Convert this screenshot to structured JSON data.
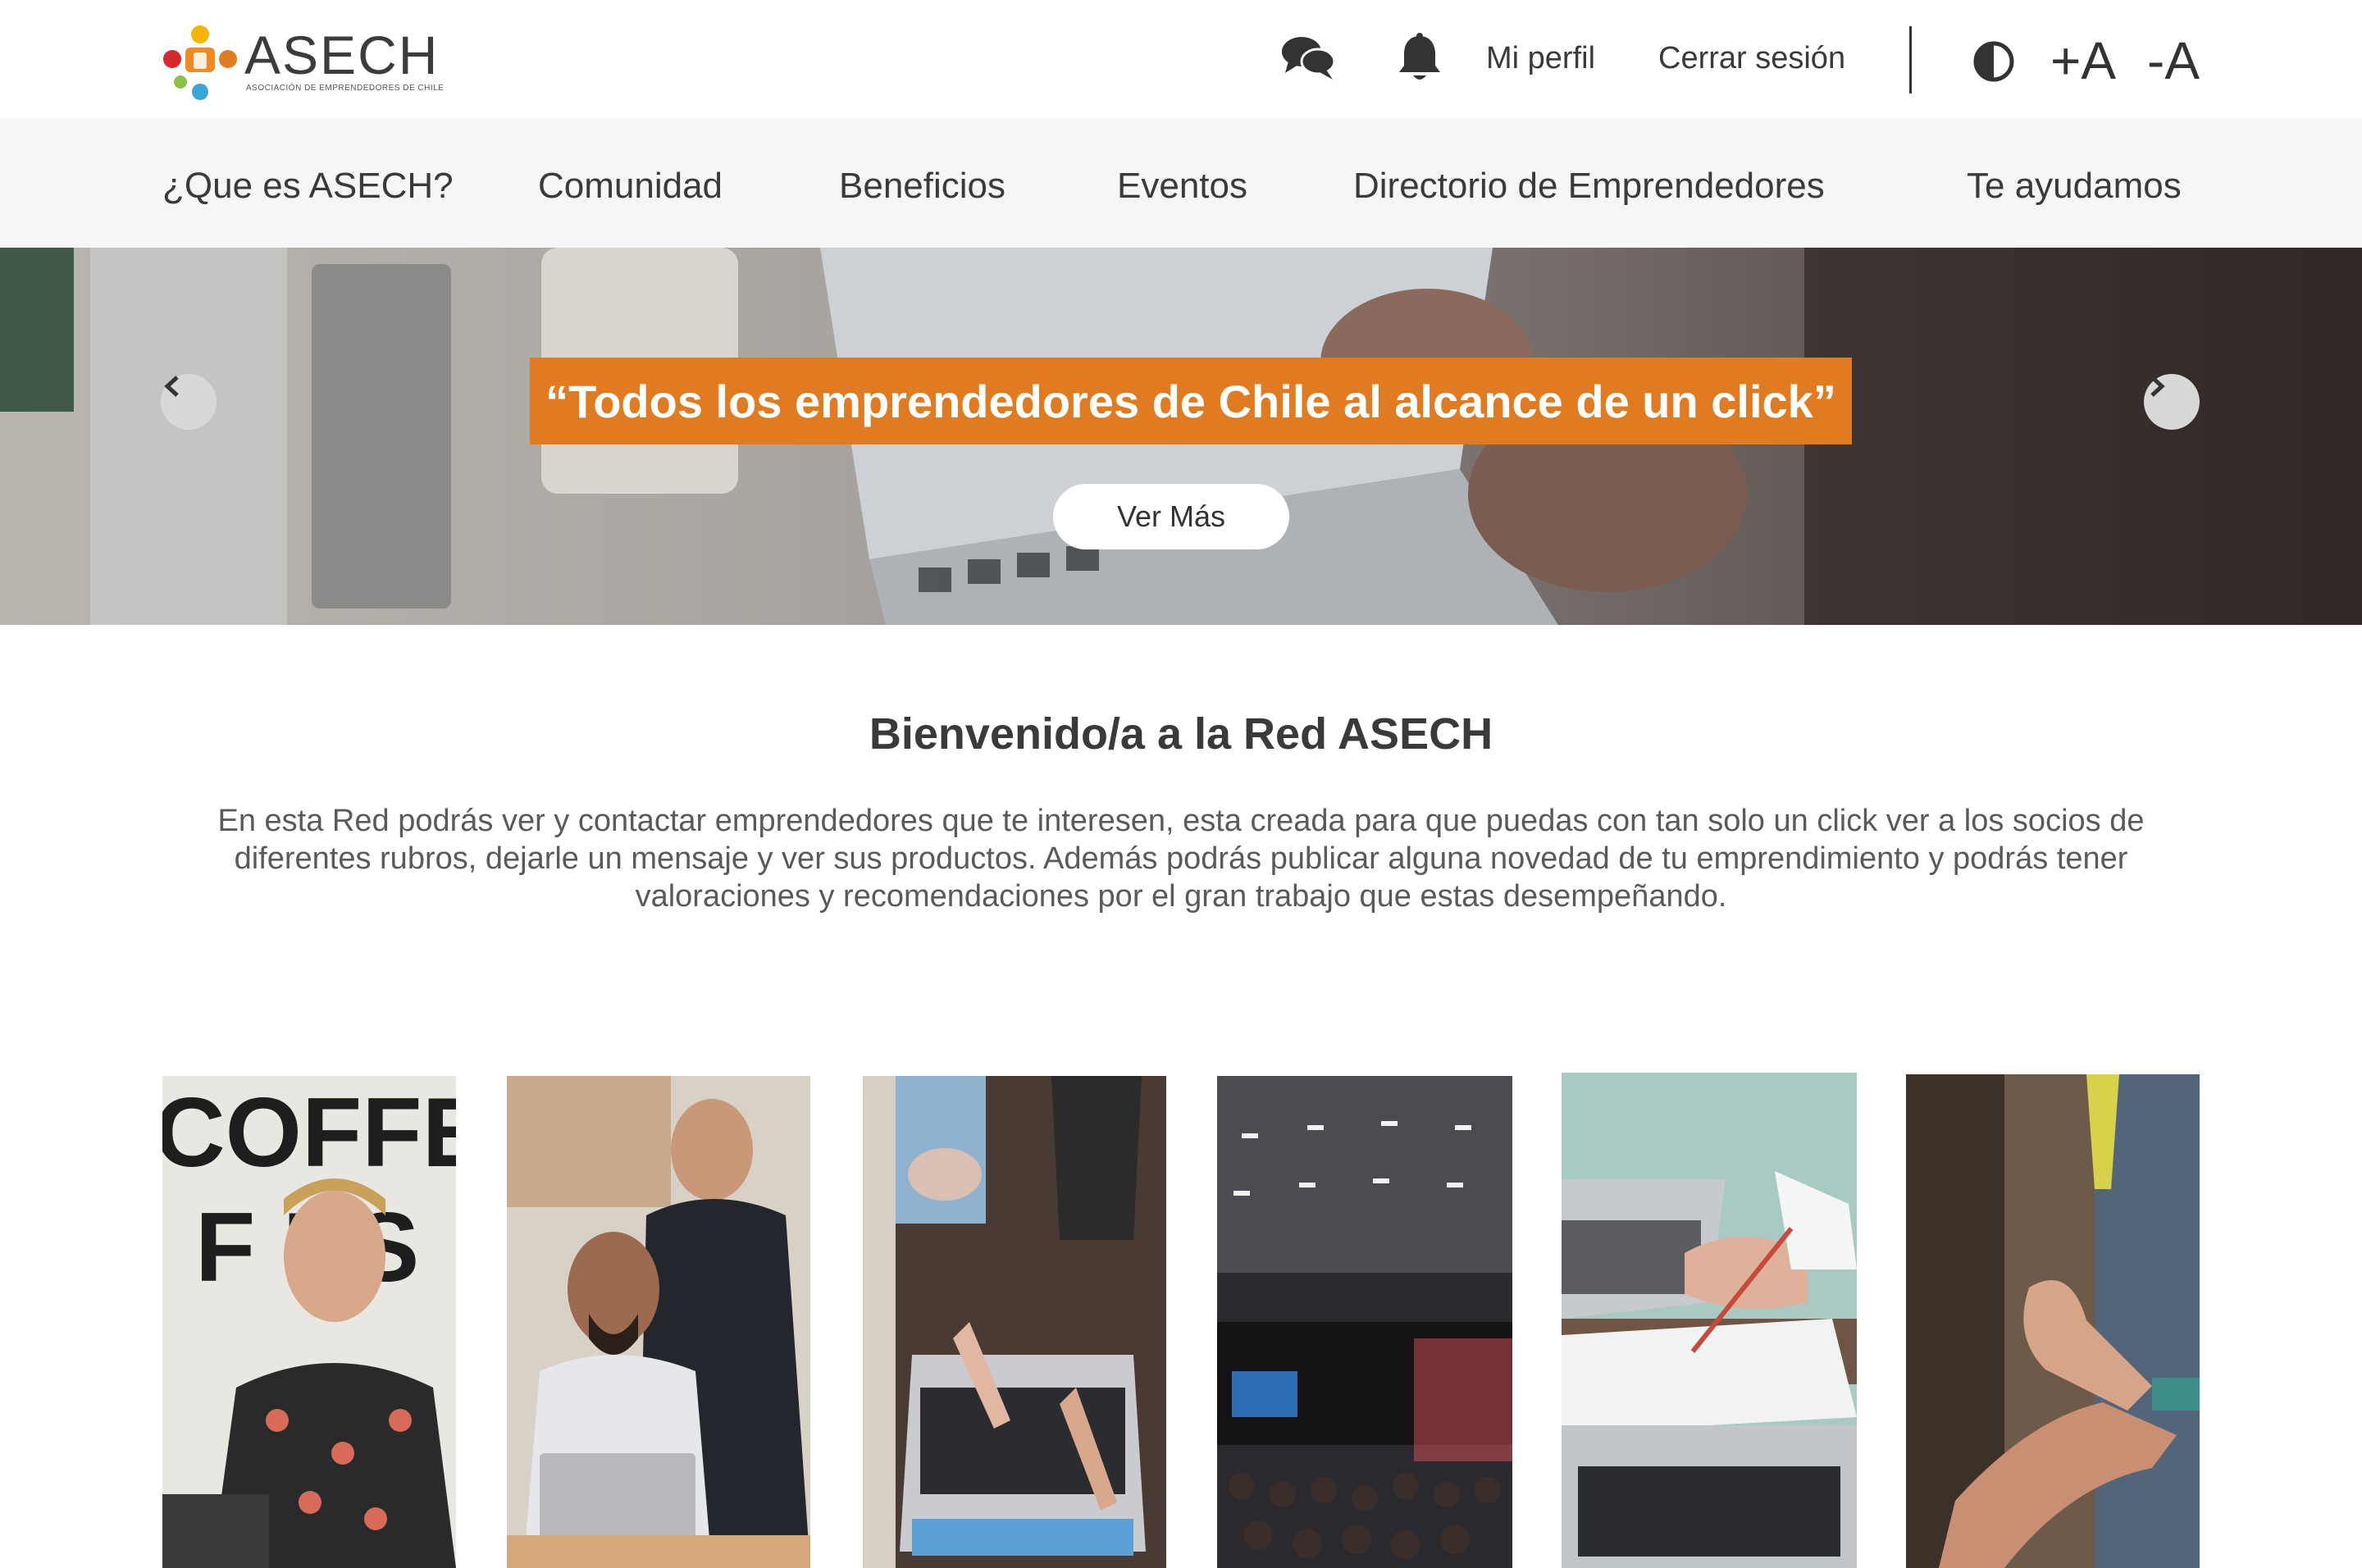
{
  "header": {
    "logo_text": "ASECH",
    "logo_subtitle": "ASOCIACIÓN DE EMPRENDEDORES DE CHILE",
    "icons": [
      "chat-icon",
      "bell-icon",
      "contrast-icon"
    ],
    "profile_label": "Mi perfil",
    "logout_label": "Cerrar sesión",
    "font_increase_label": "+A",
    "font_decrease_label": "-A"
  },
  "nav": {
    "items": [
      {
        "label": "¿Que es ASECH?"
      },
      {
        "label": "Comunidad"
      },
      {
        "label": "Beneficios"
      },
      {
        "label": "Eventos"
      },
      {
        "label": "Directorio de Emprendedores"
      },
      {
        "label": "Te ayudamos"
      }
    ]
  },
  "hero": {
    "quote": "“Todos los emprendedores de Chile al alcance de un click”",
    "button_label": "Ver Más",
    "prev_icon": "chevron-left-icon",
    "next_icon": "chevron-right-icon"
  },
  "welcome": {
    "title": "Bienvenido/a a la Red ASECH",
    "text": "En esta Red podrás ver y contactar emprendedores que te interesen, esta creada para que puedas con tan solo un click ver a los socios de diferentes rubros, dejarle un mensaje y ver sus productos. Además podrás publicar alguna novedad de tu emprendimiento y podrás tener valoraciones y recomendaciones  por el gran trabajo que estas desempeñando."
  },
  "cards": [
    {
      "image": "coffee-shop-man-phone-photo",
      "sign_text": "COFFEE"
    },
    {
      "image": "two-men-laptop-photo"
    },
    {
      "image": "hands-laptop-photo"
    },
    {
      "image": "conference-room-photo"
    },
    {
      "image": "writing-desk-laptop-photo"
    },
    {
      "image": "handshake-photo"
    }
  ],
  "colors": {
    "accent_orange": "#e07b22",
    "nav_bg": "#f6f6f6",
    "text_dark": "#3a3a3a"
  }
}
